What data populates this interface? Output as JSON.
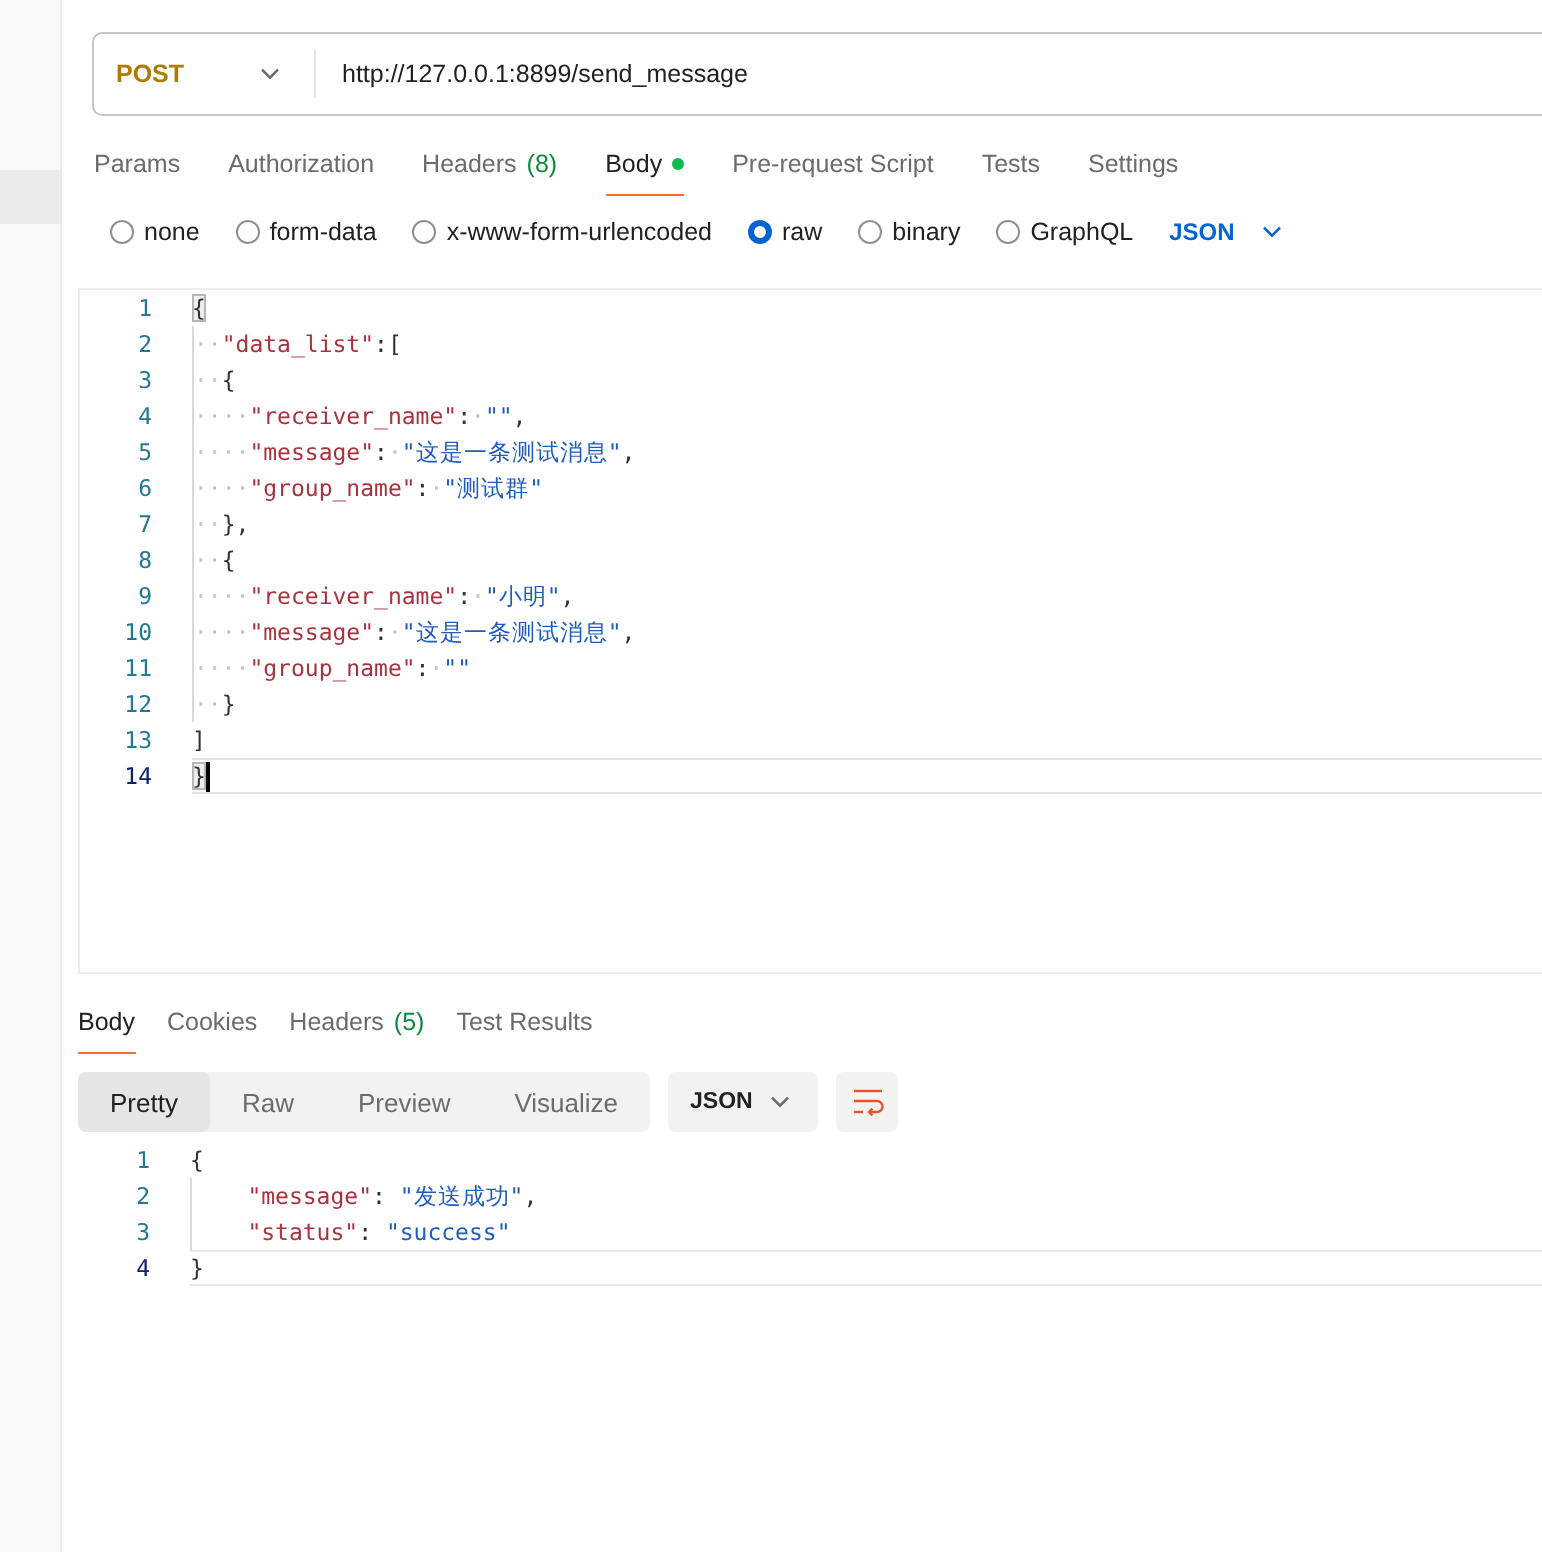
{
  "sidebar": {
    "items": [
      {
        "selected": true
      }
    ]
  },
  "request": {
    "method": "POST",
    "url": "http://127.0.0.1:8899/send_message"
  },
  "request_tabs": [
    {
      "label": "Params",
      "selected": false,
      "indicator": false
    },
    {
      "label": "Authorization",
      "selected": false,
      "indicator": false
    },
    {
      "label": "Headers",
      "count": "(8)",
      "selected": false,
      "indicator": false
    },
    {
      "label": "Body",
      "selected": true,
      "indicator": true
    },
    {
      "label": "Pre-request Script",
      "selected": false,
      "indicator": false
    },
    {
      "label": "Tests",
      "selected": false,
      "indicator": false
    },
    {
      "label": "Settings",
      "selected": false,
      "indicator": false
    }
  ],
  "body_types": [
    {
      "label": "none",
      "selected": false
    },
    {
      "label": "form-data",
      "selected": false
    },
    {
      "label": "x-www-form-urlencoded",
      "selected": false
    },
    {
      "label": "raw",
      "selected": true
    },
    {
      "label": "binary",
      "selected": false
    },
    {
      "label": "GraphQL",
      "selected": false
    }
  ],
  "body_format": "JSON",
  "request_editor": {
    "lines": [
      {
        "number": "1",
        "current": false,
        "tokens": [
          {
            "kind": "match",
            "text": "{"
          }
        ]
      },
      {
        "number": "2",
        "current": false,
        "tokens": [
          {
            "kind": "ws",
            "text": "··"
          },
          {
            "kind": "key",
            "text": "\"data_list\""
          },
          {
            "kind": "punct",
            "text": ":["
          }
        ]
      },
      {
        "number": "3",
        "current": false,
        "tokens": [
          {
            "kind": "ws",
            "text": "··"
          },
          {
            "kind": "punct",
            "text": "{"
          }
        ]
      },
      {
        "number": "4",
        "current": false,
        "tokens": [
          {
            "kind": "ws",
            "text": "····"
          },
          {
            "kind": "key",
            "text": "\"receiver_name\""
          },
          {
            "kind": "punct",
            "text": ":"
          },
          {
            "kind": "ws",
            "text": "·"
          },
          {
            "kind": "string",
            "text": "\"\""
          },
          {
            "kind": "punct",
            "text": ","
          }
        ]
      },
      {
        "number": "5",
        "current": false,
        "tokens": [
          {
            "kind": "ws",
            "text": "····"
          },
          {
            "kind": "key",
            "text": "\"message\""
          },
          {
            "kind": "punct",
            "text": ":"
          },
          {
            "kind": "ws",
            "text": "·"
          },
          {
            "kind": "string",
            "text": "\"这是一条测试消息\""
          },
          {
            "kind": "punct",
            "text": ","
          }
        ]
      },
      {
        "number": "6",
        "current": false,
        "tokens": [
          {
            "kind": "ws",
            "text": "····"
          },
          {
            "kind": "key",
            "text": "\"group_name\""
          },
          {
            "kind": "punct",
            "text": ":"
          },
          {
            "kind": "ws",
            "text": "·"
          },
          {
            "kind": "string",
            "text": "\"测试群\""
          }
        ]
      },
      {
        "number": "7",
        "current": false,
        "tokens": [
          {
            "kind": "ws",
            "text": "··"
          },
          {
            "kind": "punct",
            "text": "},"
          }
        ]
      },
      {
        "number": "8",
        "current": false,
        "tokens": [
          {
            "kind": "ws",
            "text": "··"
          },
          {
            "kind": "punct",
            "text": "{"
          }
        ]
      },
      {
        "number": "9",
        "current": false,
        "tokens": [
          {
            "kind": "ws",
            "text": "····"
          },
          {
            "kind": "key",
            "text": "\"receiver_name\""
          },
          {
            "kind": "punct",
            "text": ":"
          },
          {
            "kind": "ws",
            "text": "·"
          },
          {
            "kind": "string",
            "text": "\"小明\""
          },
          {
            "kind": "punct",
            "text": ","
          }
        ]
      },
      {
        "number": "10",
        "current": false,
        "tokens": [
          {
            "kind": "ws",
            "text": "····"
          },
          {
            "kind": "key",
            "text": "\"message\""
          },
          {
            "kind": "punct",
            "text": ":"
          },
          {
            "kind": "ws",
            "text": "·"
          },
          {
            "kind": "string",
            "text": "\"这是一条测试消息\""
          },
          {
            "kind": "punct",
            "text": ","
          }
        ]
      },
      {
        "number": "11",
        "current": false,
        "tokens": [
          {
            "kind": "ws",
            "text": "····"
          },
          {
            "kind": "key",
            "text": "\"group_name\""
          },
          {
            "kind": "punct",
            "text": ":"
          },
          {
            "kind": "ws",
            "text": "·"
          },
          {
            "kind": "string",
            "text": "\"\""
          }
        ]
      },
      {
        "number": "12",
        "current": false,
        "tokens": [
          {
            "kind": "ws",
            "text": "··"
          },
          {
            "kind": "punct",
            "text": "}"
          }
        ]
      },
      {
        "number": "13",
        "current": false,
        "tokens": [
          {
            "kind": "punct",
            "text": "]"
          }
        ]
      },
      {
        "number": "14",
        "current": true,
        "tokens": [
          {
            "kind": "match",
            "text": "}"
          }
        ]
      }
    ]
  },
  "response_tabs": [
    {
      "label": "Body",
      "selected": true
    },
    {
      "label": "Cookies",
      "selected": false
    },
    {
      "label": "Headers",
      "count": "(5)",
      "selected": false
    },
    {
      "label": "Test Results",
      "selected": false
    }
  ],
  "view_modes": [
    {
      "label": "Pretty",
      "selected": true
    },
    {
      "label": "Raw",
      "selected": false
    },
    {
      "label": "Preview",
      "selected": false
    },
    {
      "label": "Visualize",
      "selected": false
    }
  ],
  "response_format": "JSON",
  "wrap_lines": true,
  "response_viewer": {
    "lines": [
      {
        "number": "1",
        "current": false,
        "tokens": [
          {
            "kind": "punct",
            "text": "{"
          }
        ],
        "children": [
          {
            "number": "2",
            "current": false,
            "tokens": [
              {
                "kind": "key",
                "text": "\"message\""
              },
              {
                "kind": "punct",
                "text": ": "
              },
              {
                "kind": "string",
                "text": "\"发送成功\""
              },
              {
                "kind": "punct",
                "text": ","
              }
            ]
          },
          {
            "number": "3",
            "current": false,
            "tokens": [
              {
                "kind": "key",
                "text": "\"status\""
              },
              {
                "kind": "punct",
                "text": ": "
              },
              {
                "kind": "string",
                "text": "\"success\""
              }
            ]
          }
        ]
      },
      {
        "number": "4",
        "current": true,
        "tokens": [
          {
            "kind": "punct",
            "text": "}"
          }
        ]
      }
    ]
  }
}
